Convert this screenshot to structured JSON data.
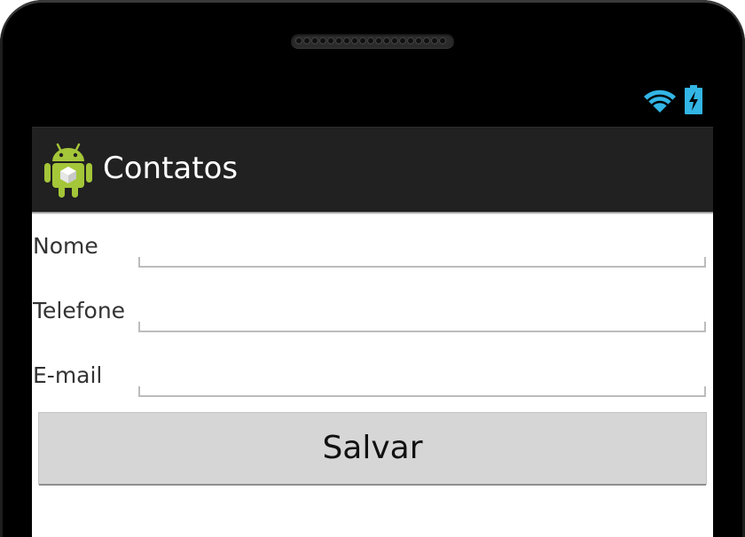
{
  "app": {
    "title": "Contatos",
    "icon": "android-robot-icon"
  },
  "status_bar": {
    "icons": [
      "wifi-icon",
      "battery-charging-icon"
    ],
    "accent_color": "#33b5e5"
  },
  "form": {
    "fields": [
      {
        "label": "Nome",
        "value": "",
        "placeholder": ""
      },
      {
        "label": "Telefone",
        "value": "",
        "placeholder": ""
      },
      {
        "label": "E-mail",
        "value": "",
        "placeholder": ""
      }
    ],
    "save_label": "Salvar"
  },
  "colors": {
    "action_bar": "#212121",
    "button": "#d6d6d6",
    "android_green": "#a4c639"
  }
}
